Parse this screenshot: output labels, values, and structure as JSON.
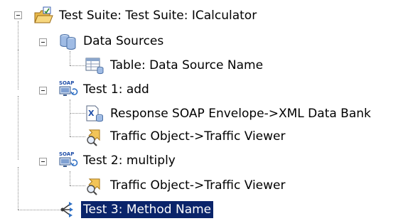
{
  "tree": {
    "nodes": [
      {
        "label": "Test Suite: Test Suite: ICalculator",
        "icon": "test-suite-folder-icon"
      },
      {
        "label": "Data Sources",
        "icon": "data-sources-icon"
      },
      {
        "label": "Table: Data Source Name",
        "icon": "table-icon"
      },
      {
        "label": "Test 1: add",
        "icon": "soap-client-icon",
        "icon_text": "SOAP"
      },
      {
        "label": "Response SOAP Envelope->XML Data Bank",
        "icon": "xml-data-bank-icon",
        "icon_text": "X"
      },
      {
        "label": "Traffic Object->Traffic Viewer",
        "icon": "traffic-viewer-icon"
      },
      {
        "label": "Test 2: multiply",
        "icon": "soap-client-icon",
        "icon_text": "SOAP"
      },
      {
        "label": "Traffic Object->Traffic Viewer",
        "icon": "traffic-viewer-icon"
      },
      {
        "label": "Test 3: Method Name",
        "icon": "method-test-icon",
        "selected": true
      }
    ],
    "colors": {
      "selection_bg": "#0a246a",
      "selection_fg": "#ffffff",
      "connector": "#8c8c8c"
    }
  }
}
